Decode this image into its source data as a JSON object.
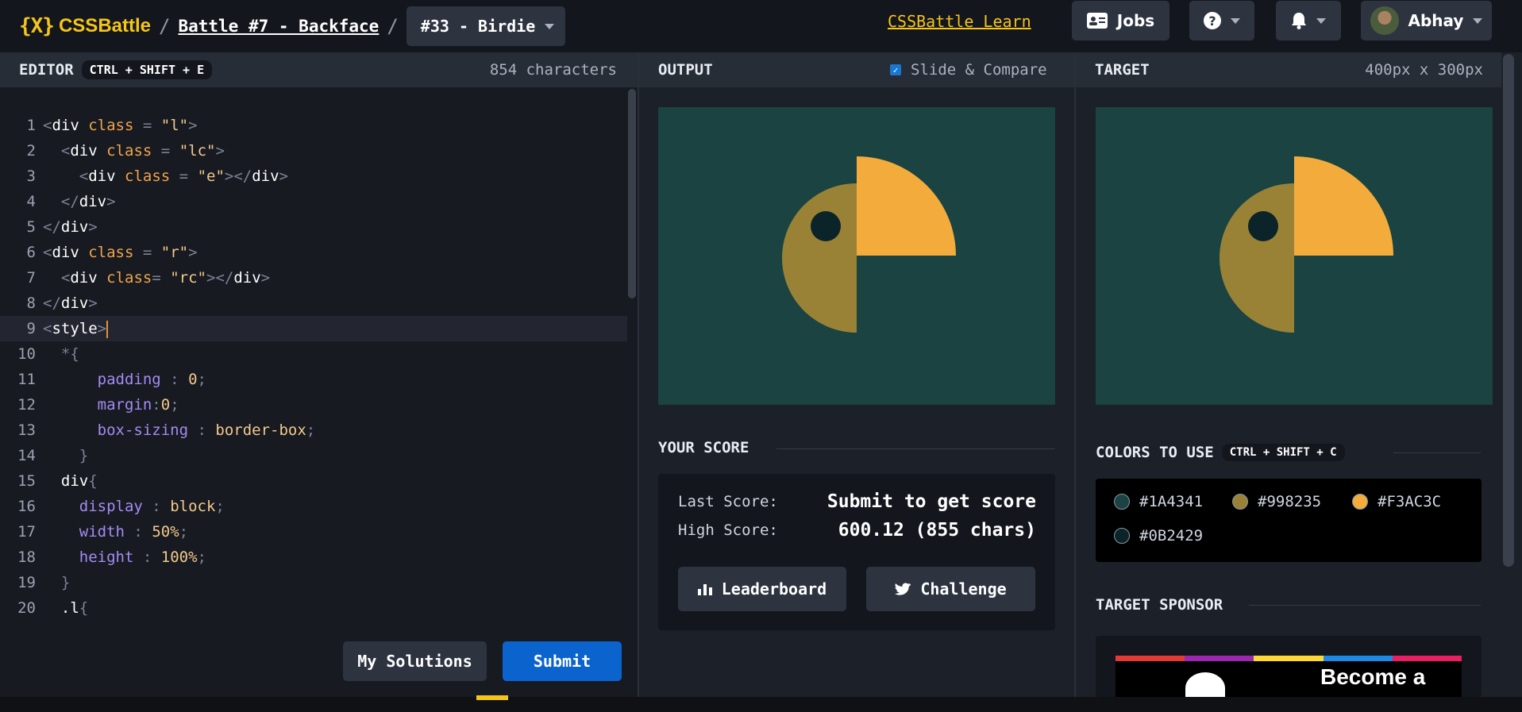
{
  "header": {
    "logo_mark": "{X}",
    "logo_text": "CSSBattle",
    "separator": "/",
    "battle_title": "Battle #7 - Backface",
    "target_selector": "#33 - Birdie",
    "learn_link": "CSSBattle Learn",
    "jobs_label": "Jobs",
    "help_icon": "?",
    "user_name": "Abhay"
  },
  "editor": {
    "title": "EDITOR",
    "shortcut": "CTRL + SHIFT + E",
    "char_count": "854 characters",
    "lines": [
      {
        "n": "1",
        "t": "<div class = \"l\">"
      },
      {
        "n": "2",
        "t": "  <div class = \"lc\">"
      },
      {
        "n": "3",
        "t": "    <div class = \"e\"></div>"
      },
      {
        "n": "4",
        "t": "  </div>"
      },
      {
        "n": "5",
        "t": "</div>"
      },
      {
        "n": "6",
        "t": "<div class = \"r\">"
      },
      {
        "n": "7",
        "t": "  <div class= \"rc\"></div>"
      },
      {
        "n": "8",
        "t": "</div>"
      },
      {
        "n": "9",
        "t": "<style>"
      },
      {
        "n": "10",
        "t": "  *{"
      },
      {
        "n": "11",
        "t": "      padding : 0;"
      },
      {
        "n": "12",
        "t": "      margin:0;"
      },
      {
        "n": "13",
        "t": "      box-sizing : border-box;"
      },
      {
        "n": "14",
        "t": "    }"
      },
      {
        "n": "15",
        "t": "  div{"
      },
      {
        "n": "16",
        "t": "    display : block;"
      },
      {
        "n": "17",
        "t": "    width : 50%;"
      },
      {
        "n": "18",
        "t": "    height : 100%;"
      },
      {
        "n": "19",
        "t": "  }"
      },
      {
        "n": "20",
        "t": "  .l{"
      }
    ],
    "my_solutions_label": "My Solutions",
    "submit_label": "Submit"
  },
  "output": {
    "title": "OUTPUT",
    "slide_compare_label": "Slide & Compare",
    "slide_compare_checked": true
  },
  "target": {
    "title": "TARGET",
    "dimensions": "400px x 300px"
  },
  "score": {
    "title": "YOUR SCORE",
    "last_score_label": "Last Score:",
    "last_score_value": "Submit to get score",
    "high_score_label": "High Score:",
    "high_score_value": "600.12 (855 chars)",
    "leaderboard_label": "Leaderboard",
    "challenge_label": "Challenge"
  },
  "colors": {
    "title": "COLORS TO USE",
    "shortcut": "CTRL + SHIFT + C",
    "swatches": [
      {
        "hex": "#1A4341"
      },
      {
        "hex": "#998235"
      },
      {
        "hex": "#F3AC3C"
      },
      {
        "hex": "#0B2429"
      }
    ]
  },
  "sponsor": {
    "title": "TARGET SPONSOR",
    "headline": "Become a"
  },
  "theme": {
    "accent": "#f5c518",
    "submit_blue": "#0b63ce"
  }
}
